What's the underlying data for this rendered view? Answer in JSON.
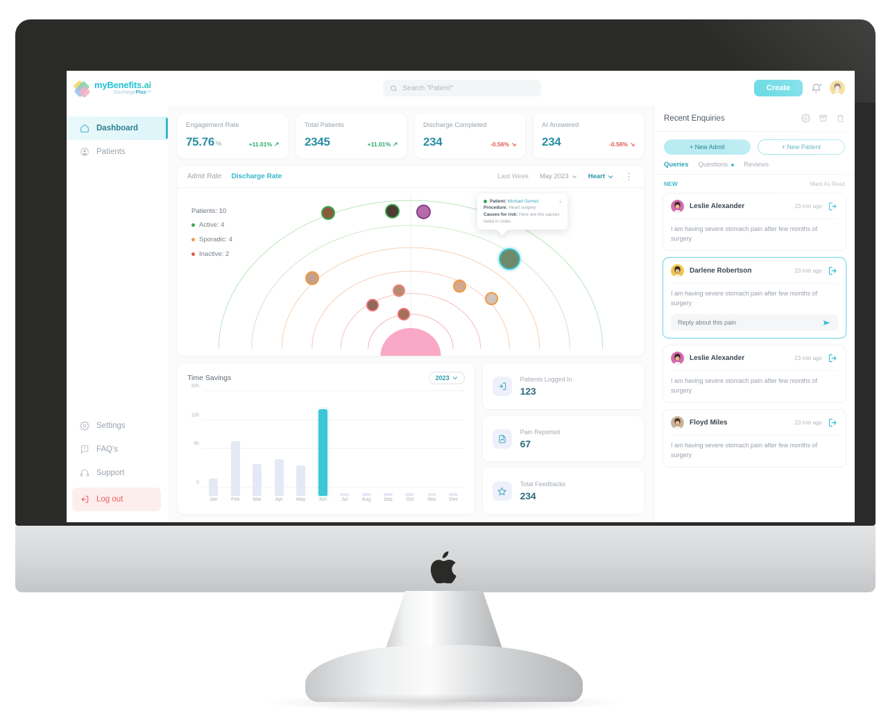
{
  "brand": {
    "name_a": "myBenefits",
    "name_b": ".ai",
    "sub_a": "Discharge",
    "sub_b": "Plus",
    "sub_tm": "™"
  },
  "sidebar": {
    "items": [
      {
        "label": "Dashboard",
        "icon": "home-icon",
        "active": true
      },
      {
        "label": "Patients",
        "icon": "user-circle-icon",
        "active": false
      }
    ],
    "bottom_items": [
      {
        "label": "Settings",
        "icon": "gear-icon"
      },
      {
        "label": "FAQ's",
        "icon": "chat-bubble-icon"
      },
      {
        "label": "Support",
        "icon": "headset-icon"
      }
    ],
    "logout": {
      "label": "Log out",
      "icon": "logout-icon"
    }
  },
  "topbar": {
    "search_placeholder": "Search \"Patient\"",
    "search_value": "",
    "search_icon": "search-icon",
    "create_label": "Create",
    "bell_icon": "bell-icon",
    "avatar": "user-avatar"
  },
  "kpis": [
    {
      "label": "Engagement Rate",
      "value": "75.76",
      "unit": "%",
      "delta": "+11.01%",
      "dir": "up"
    },
    {
      "label": "Total Patients",
      "value": "2345",
      "unit": "",
      "delta": "+11.01%",
      "dir": "up"
    },
    {
      "label": "Discharge Completed",
      "value": "234",
      "unit": "",
      "delta": "-0.56%",
      "dir": "down"
    },
    {
      "label": "AI Answered",
      "value": "234",
      "unit": "",
      "delta": "-0.56%",
      "dir": "down"
    }
  ],
  "radial": {
    "tabs": [
      {
        "label": "Admit Rate",
        "active": false
      },
      {
        "label": "Discharge Rate",
        "active": true
      }
    ],
    "last_week": "Last Week",
    "month_select": "May 2023",
    "category_select": "Heart",
    "more_icon": "more-vertical-icon",
    "legend": {
      "total_label": "Patients: 10",
      "rows": [
        {
          "label": "Active: 4",
          "color": "#3aa84f"
        },
        {
          "label": "Sporadic: 4",
          "color": "#f09a3e"
        },
        {
          "label": "Inactive: 2",
          "color": "#e2574c"
        }
      ]
    },
    "tooltip": {
      "patient_label": "Patient:",
      "patient_name": "Michael Gomez",
      "procedure_label": "Procedure:",
      "procedure_value": "Heart surgery",
      "causes_label": "Causes for risk:",
      "causes_value": "Here are the causes listed in order.",
      "chevron": "chevron-right-icon"
    }
  },
  "chart_data": {
    "type": "bar",
    "title": "Time Savings",
    "year": "2023",
    "xlabel": "",
    "ylabel": "",
    "categories": [
      "Jan",
      "Feb",
      "Mar",
      "Apr",
      "May",
      "Jun",
      "Jul",
      "Aug",
      "Sep",
      "Oct",
      "Nov",
      "Dec"
    ],
    "values": [
      5.5,
      17,
      10,
      11.5,
      9.5,
      27,
      0.2,
      0.2,
      0.2,
      0.2,
      0.2,
      0.2
    ],
    "ytick_labels": [
      "30h",
      "10h",
      "5h",
      "0"
    ],
    "ytick_positions_pct": [
      100,
      72,
      45,
      8
    ],
    "ylim": [
      0,
      30
    ],
    "highlight_index": 5,
    "bar_color": "#e5e8f5",
    "highlight_color": "#3cc6d6",
    "grid": true,
    "legend_position": "none"
  },
  "stats": [
    {
      "label": "Patients Logged In",
      "value": "123",
      "icon": "login-arrow-icon"
    },
    {
      "label": "Pain Reported",
      "value": "67",
      "icon": "report-document-icon"
    },
    {
      "label": "Total Feedbacks",
      "value": "234",
      "icon": "star-icon"
    }
  ],
  "right_panel": {
    "title": "Recent Enquiries",
    "header_icons": [
      {
        "name": "gear-icon"
      },
      {
        "name": "archive-icon"
      },
      {
        "name": "trash-icon"
      }
    ],
    "actions": [
      {
        "label": "+ New Admit",
        "style": "solid"
      },
      {
        "label": "+ New Patient",
        "style": "outline"
      }
    ],
    "tabs": [
      {
        "label": "Queries",
        "active": true,
        "dot": false
      },
      {
        "label": "Questions",
        "active": false,
        "dot": true
      },
      {
        "label": "Reviews",
        "active": false,
        "dot": false
      }
    ],
    "new_label": "NEW",
    "mark_as_read": "Mark As Read",
    "enquiries": [
      {
        "name": "Leslie Alexander",
        "time": "23 min ago",
        "message": "I am having severe stomach pain after few months of surgery",
        "selected": false,
        "reply_placeholder": null,
        "avatar_bg": "#d46ab0",
        "avatar_hair": "#3a2a23",
        "open_icon": "open-external-icon"
      },
      {
        "name": "Darlene Robertson",
        "time": "23 min ago",
        "message": "I am having severe stomach pain after few months of surgery",
        "selected": true,
        "reply_placeholder": "Reply about this pain",
        "avatar_bg": "#f0c44e",
        "avatar_hair": "#2f2a27",
        "open_icon": "open-external-icon"
      },
      {
        "name": "Leslie Alexander",
        "time": "23 min ago",
        "message": "I am having severe stomach pain after few months of surgery",
        "selected": false,
        "reply_placeholder": null,
        "avatar_bg": "#d46ab0",
        "avatar_hair": "#3a2a23",
        "open_icon": "open-external-icon"
      },
      {
        "name": "Floyd Miles",
        "time": "23 min ago",
        "message": "I am having severe stomach pain after few months of surgery",
        "selected": false,
        "reply_placeholder": null,
        "avatar_bg": "#c9b49a",
        "avatar_hair": "#4a3528",
        "open_icon": "open-external-icon"
      }
    ],
    "reply_send_icon": "send-icon"
  },
  "colors": {
    "accent": "#3cc6d6",
    "accent_dark": "#2b8fa3",
    "positive": "#2aa96a",
    "negative": "#e2574c",
    "active_node": "#3aa84f",
    "sporadic_node": "#f09a3e",
    "inactive_node": "#e2574c"
  }
}
